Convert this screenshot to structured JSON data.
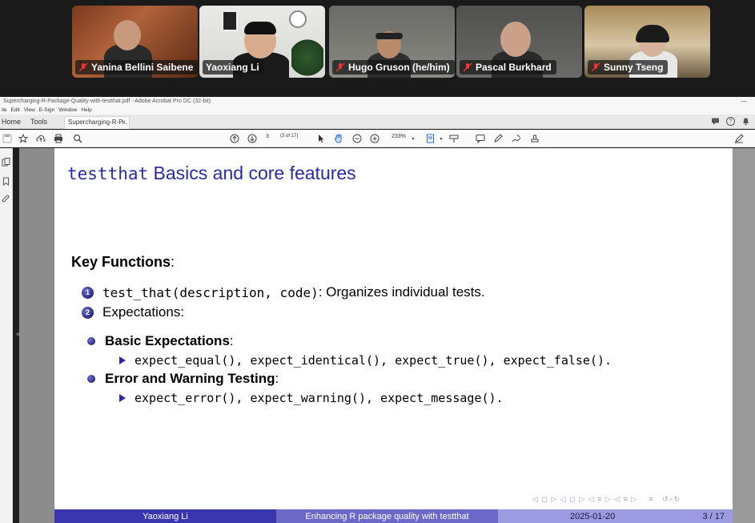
{
  "meeting": {
    "participants": [
      {
        "name": "Yanina Bellini Saibene",
        "muted": true
      },
      {
        "name": "Yaoxiang Li",
        "muted": true,
        "active_speaker": true
      },
      {
        "name": "Hugo Gruson (he/him)",
        "muted": true
      },
      {
        "name": "Pascal Burkhard",
        "muted": true
      },
      {
        "name": "Sunny Tseng",
        "muted": true
      }
    ]
  },
  "acrobat": {
    "window_title": "Supercharging-R-Package-Quality-with-testthat.pdf - Adobe Acrobat Pro DC (32-bit)",
    "menu": [
      "ile",
      "Edit",
      "View",
      "E-Sign",
      "Window",
      "Help"
    ],
    "nav_tabs": {
      "home": "Home",
      "tools": "Tools"
    },
    "doc_tab": "Supercharging-R-P...",
    "page_current": "3",
    "page_of": "(3 of 17)",
    "zoom": "233%"
  },
  "slide": {
    "title_mono": "testthat",
    "title_rest": " Basics and core features",
    "key_functions_label": "Key Functions",
    "items": [
      {
        "num": "1",
        "code": "test_that(description, code)",
        "text": ": Organizes individual tests."
      },
      {
        "num": "2",
        "text": "Expectations:"
      }
    ],
    "groups": [
      {
        "heading": "Basic Expectations",
        "content": "expect_equal(), expect_identical(), expect_true(), expect_false()."
      },
      {
        "heading": "Error and Warning Testing",
        "content": "expect_error(), expect_warning(), expect_message()."
      }
    ],
    "footer": {
      "author": "Yaoxiang Li",
      "title": "Enhancing R package quality with testthat",
      "date": "2025-01-20",
      "page": "3 / 17"
    }
  }
}
